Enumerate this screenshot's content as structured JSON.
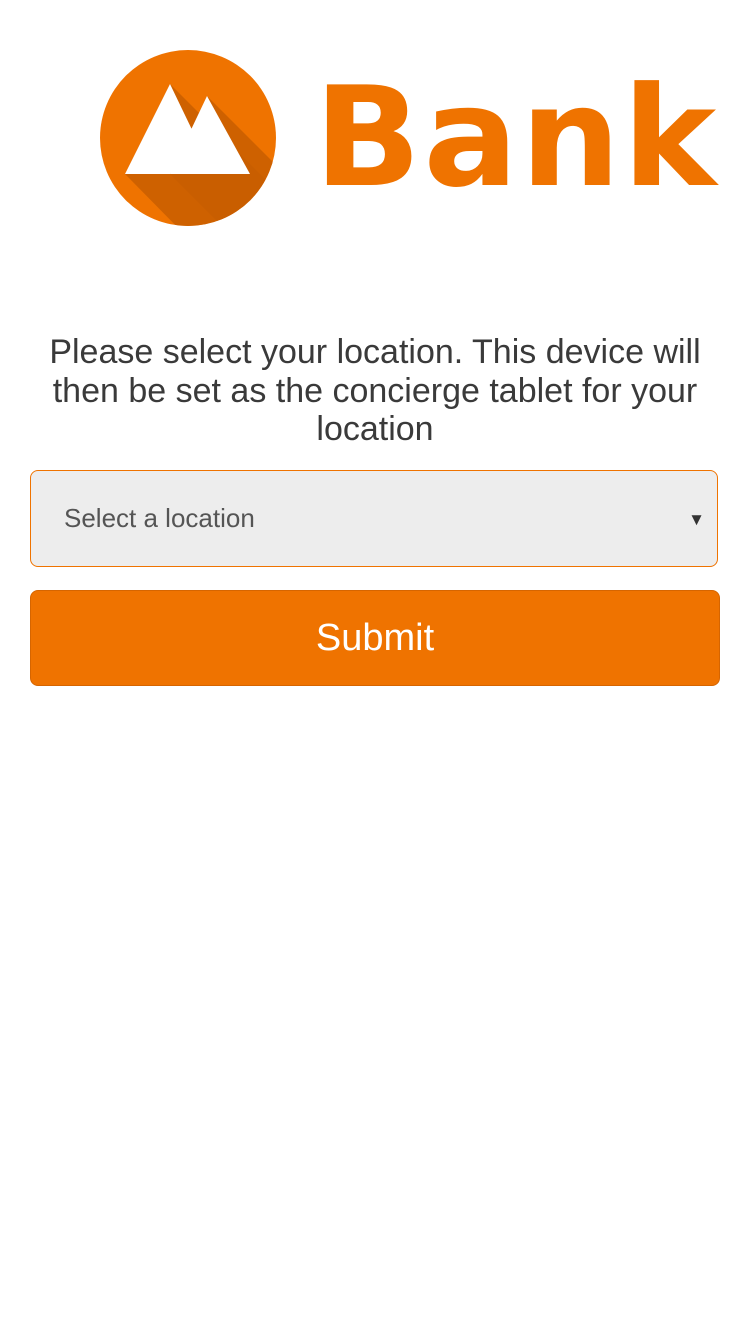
{
  "brand": {
    "logo_text": "Bank",
    "logo_icon": "mountain-logo-icon",
    "primary_color": "#ef7300"
  },
  "instructions": "Please select your location. This device will then be set as the concierge tablet for your location",
  "location_select": {
    "selected_value": "Select a location",
    "arrow_icon": "caret-down-icon"
  },
  "submit_label": "Submit"
}
